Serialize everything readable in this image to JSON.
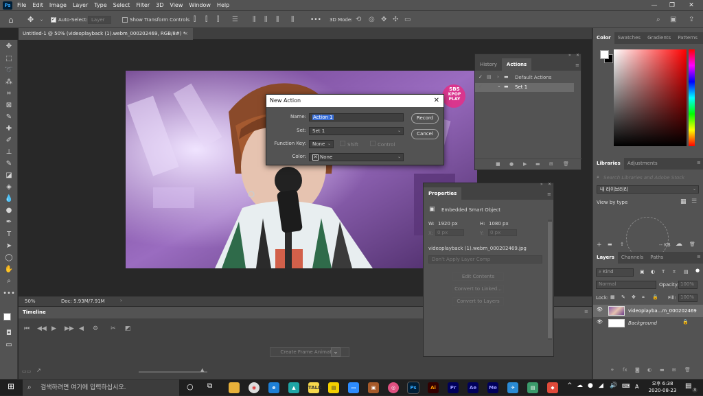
{
  "app": {
    "logo": "Ps"
  },
  "menu": [
    "File",
    "Edit",
    "Image",
    "Layer",
    "Type",
    "Select",
    "Filter",
    "3D",
    "View",
    "Window",
    "Help"
  ],
  "options": {
    "auto_select_label": "Auto-Select:",
    "auto_select_value": "Layer",
    "show_transform_label": "Show Transform Controls",
    "mode_3d_label": "3D Mode:",
    "more": "•••"
  },
  "document": {
    "tab_title": "Untitled-1 @ 50% (videoplayback (1).webm_000202469, RGB/8#) *",
    "close": "×"
  },
  "status": {
    "zoom": "50%",
    "doc_info": "Doc: 5.93M/7.91M"
  },
  "timeline": {
    "title": "Timeline",
    "create_frame": "Create Frame Animation"
  },
  "dialog": {
    "title": "New Action",
    "name_label": "Name:",
    "name_value": "Action 1",
    "set_label": "Set:",
    "set_value": "Set 1",
    "fkey_label": "Function Key:",
    "fkey_value": "None",
    "shift_label": "Shift",
    "control_label": "Control",
    "color_label": "Color:",
    "color_value": "None",
    "record_button": "Record",
    "cancel_button": "Cancel"
  },
  "history_panel": {
    "tabs": [
      "History",
      "Actions"
    ],
    "items": [
      "Default Actions",
      "Set 1"
    ]
  },
  "properties": {
    "title": "Properties",
    "type": "Embedded Smart Object",
    "w_label": "W:",
    "w_value": "1920 px",
    "h_label": "H:",
    "h_value": "1080 px",
    "x_label": "X:",
    "x_placeholder": "0 px",
    "y_label": "Y:",
    "y_placeholder": "0 px",
    "filename": "videoplayback (1).webm_000202469.jpg",
    "layer_comp": "Don't Apply Layer Comp",
    "edit_contents": "Edit Contents",
    "convert_linked": "Convert to Linked...",
    "convert_layers": "Convert to Layers"
  },
  "color_panel": {
    "tabs": [
      "Color",
      "Swatches",
      "Gradients",
      "Patterns"
    ]
  },
  "libraries": {
    "tabs": [
      "Libraries",
      "Adjustments"
    ],
    "search_placeholder": "Search Libraries and Adobe Stock",
    "library_name": "내 라이브러리",
    "view_by": "View by type",
    "size": "-- KB"
  },
  "layers": {
    "tabs": [
      "Layers",
      "Channels",
      "Paths"
    ],
    "kind": "Kind",
    "blend": "Normal",
    "opacity_label": "Opacity:",
    "opacity_value": "100%",
    "lock_label": "Lock:",
    "fill_label": "Fill:",
    "fill_value": "100%",
    "rows": [
      {
        "name": "videoplayba...m_000202469"
      },
      {
        "name": "Background"
      }
    ]
  },
  "taskbar": {
    "search_placeholder": "검색하려면 여기에 입력하십시오.",
    "time": "오후 6:38",
    "date": "2020-08-23",
    "lang": "A",
    "notif_count": "3"
  },
  "watermark": {
    "line1": "SBS",
    "line2": "KPOP",
    "line3": "PLAY"
  }
}
